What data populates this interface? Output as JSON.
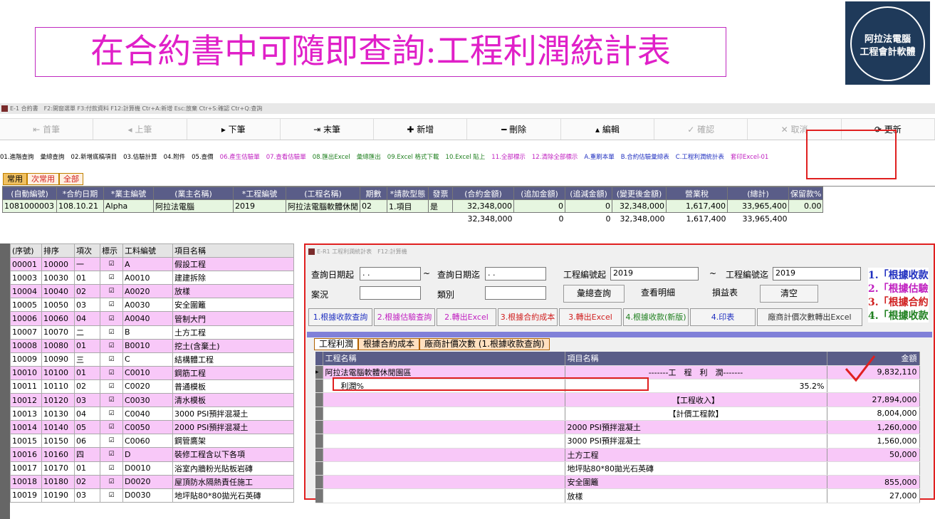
{
  "slide_title": "在合約書中可隨即查詢:工程利潤統計表",
  "logo": {
    "line1": "阿拉法電腦",
    "line2": "工程會計軟體"
  },
  "app_title": "E-1 合約書　F2:開窗選單 F3:付款資料 F12:計算機 Ctr+A:新增 Esc:放棄 Ctr+S:確認 Ctr+Q:查詢",
  "nav": [
    {
      "label": "⇤ 首筆",
      "dim": true
    },
    {
      "label": "◂ 上筆",
      "dim": true
    },
    {
      "label": "▸ 下筆",
      "dim": false
    },
    {
      "label": "⇥ 末筆",
      "dim": false
    },
    {
      "label": "✚ 新增",
      "dim": false
    },
    {
      "label": "━ 刪除",
      "dim": false
    },
    {
      "label": "▴ 編輯",
      "dim": false
    },
    {
      "label": "✓ 確認",
      "dim": true
    },
    {
      "label": "✕ 取消",
      "dim": true
    },
    {
      "label": "⟳ 更新",
      "dim": false
    }
  ],
  "funcs": [
    {
      "label": "01.進階查詢",
      "c": ""
    },
    {
      "label": "彙總查詢",
      "c": ""
    },
    {
      "label": "02.新增底稿項目",
      "c": ""
    },
    {
      "label": "03.估驗計算",
      "c": ""
    },
    {
      "label": "04.附件",
      "c": ""
    },
    {
      "label": "05.查價",
      "c": ""
    },
    {
      "label": "06.產生估驗單",
      "c": "pk"
    },
    {
      "label": "07.查看估驗單",
      "c": "pk"
    },
    {
      "label": "08.匯出Excel",
      "c": "gr"
    },
    {
      "label": "彙總匯出",
      "c": "gr"
    },
    {
      "label": "09.Excel 格式下載",
      "c": "gr"
    },
    {
      "label": "10.Excel 貼上",
      "c": "gr"
    },
    {
      "label": "11.全部標示",
      "c": "pk"
    },
    {
      "label": "12.清除全部標示",
      "c": "pk"
    },
    {
      "label": "A.重刷本單",
      "c": "bl"
    },
    {
      "label": "B.合約估驗彙總表",
      "c": "bl"
    },
    {
      "label": "C.工程利潤統計表",
      "c": "bl"
    },
    {
      "label": "套印Excel-01",
      "c": "pk"
    }
  ],
  "tabs1": [
    "常用",
    "次常用",
    "全部"
  ],
  "top_headers": [
    "(自動編號)",
    "*合約日期",
    "*業主編號",
    "(業主名稱)",
    "*工程編號",
    "(工程名稱)",
    "期數",
    "*請款型態",
    "發票",
    "(合約金額)",
    "(追加金額)",
    "(追減金額)",
    "(變更後金額)",
    "營業稅",
    "(總計)",
    "保留款%"
  ],
  "top_row": [
    "1081000003",
    "108.10.21",
    "Alpha",
    "阿拉法電腦",
    "2019",
    "阿拉法電腦軟體休閒",
    "02",
    "1.項目",
    "是",
    "32,348,000",
    "0",
    "0",
    "32,348,000",
    "1,617,400",
    "33,965,400",
    "0.00"
  ],
  "top_totals": [
    "32,348,000",
    "0",
    "0",
    "32,348,000",
    "1,617,400",
    "33,965,400"
  ],
  "left_headers": [
    "(序號)",
    "排序",
    "項次",
    "標示",
    "工料編號",
    "項目名稱"
  ],
  "left_rows": [
    [
      "00001",
      "10000",
      "一",
      "☑",
      "A",
      "假設工程"
    ],
    [
      "10003",
      "10030",
      "01",
      "☑",
      "A0010",
      "建建拆除"
    ],
    [
      "10004",
      "10040",
      "02",
      "☑",
      "A0020",
      "放樣"
    ],
    [
      "10005",
      "10050",
      "03",
      "☑",
      "A0030",
      "安全圍籬"
    ],
    [
      "10006",
      "10060",
      "04",
      "☑",
      "A0040",
      "管制大門"
    ],
    [
      "10007",
      "10070",
      "二",
      "☑",
      "B",
      "土方工程"
    ],
    [
      "10008",
      "10080",
      "01",
      "☑",
      "B0010",
      "挖土(含棄土)"
    ],
    [
      "10009",
      "10090",
      "三",
      "☑",
      "C",
      "結構體工程"
    ],
    [
      "10010",
      "10100",
      "01",
      "☑",
      "C0010",
      "鋼筋工程"
    ],
    [
      "10011",
      "10110",
      "02",
      "☑",
      "C0020",
      "普通模板"
    ],
    [
      "10012",
      "10120",
      "03",
      "☑",
      "C0030",
      "清水模板"
    ],
    [
      "10013",
      "10130",
      "04",
      "☑",
      "C0040",
      "3000 PSI預拌混凝土"
    ],
    [
      "10014",
      "10140",
      "05",
      "☑",
      "C0050",
      "2000 PSI預拌混凝土"
    ],
    [
      "10015",
      "10150",
      "06",
      "☑",
      "C0060",
      "鋼管鷹架"
    ],
    [
      "10016",
      "10160",
      "四",
      "☑",
      "D",
      "裝修工程含以下各項"
    ],
    [
      "10017",
      "10170",
      "01",
      "☑",
      "D0010",
      "浴室內牆粉光貼板岩磚"
    ],
    [
      "10018",
      "10180",
      "02",
      "☑",
      "D0020",
      "屋頂防水隔熱責任施工"
    ],
    [
      "10019",
      "10190",
      "03",
      "☑",
      "D0030",
      "地坪貼80*80拋光石英磚"
    ]
  ],
  "win": {
    "title": "E-R1 工程利潤統計表　F12:計算機",
    "date_from_label": "查詢日期起",
    "date_from": " . .",
    "tilde": "~",
    "date_to_label": "查詢日期迄",
    "date_to": " . .",
    "proj_from_label": "工程編號起",
    "proj_from": "2019",
    "proj_to_label": "工程編號迄",
    "proj_to": "2019",
    "case_label": "案況",
    "type_label": "類別",
    "btn_summary": "彙總查詢",
    "btn_detail": "查看明細",
    "btn_pl": "損益表",
    "btn_clear": "清空",
    "notes": [
      {
        "t": "1.「根據收款",
        "c": "#2030c0"
      },
      {
        "t": "2.「根據估驗",
        "c": "#c020c0"
      },
      {
        "t": "3.「根據合約",
        "c": "#d02020"
      },
      {
        "t": "4.「根據收款",
        "c": "#208020"
      }
    ],
    "btns2": [
      {
        "t": "1.根據收款查詢",
        "c": "#2030c0"
      },
      {
        "t": "2.根據估驗查詢",
        "c": "#c020c0"
      },
      {
        "t": "2.轉出Excel",
        "c": "#c020c0"
      },
      {
        "t": "3.根據合約成本",
        "c": "#d02020"
      },
      {
        "t": "3.轉出Excel",
        "c": "#d02020"
      },
      {
        "t": "4.根據收款(新版)",
        "c": "#208020"
      },
      {
        "t": "4.印表",
        "c": "#2030c0"
      },
      {
        "t": "廠商計價次數轉出Excel",
        "c": "#333"
      }
    ],
    "tabs": [
      "工程利潤",
      "根據合約成本",
      "廠商計價次數 (1.根據收款查詢)"
    ],
    "grid_headers": [
      "工程名稱",
      "項目名稱",
      "金額"
    ],
    "rows": [
      {
        "a": "阿拉法電腦軟體休閒園區",
        "b": "-------工　程　利　潤-------",
        "c": "9,832,110",
        "p": true,
        "cur": true
      },
      {
        "a": "　　利潤%",
        "b": "35.2%",
        "c": "",
        "p": false
      },
      {
        "a": "",
        "b": "【工程收入】",
        "c": "27,894,000",
        "p": true
      },
      {
        "a": "",
        "b": "【計價工程款】",
        "c": "8,004,000",
        "p": false
      },
      {
        "a": "",
        "b": "2000 PSI預拌混凝土",
        "c": "1,260,000",
        "p": true
      },
      {
        "a": "",
        "b": "3000 PSI預拌混凝土",
        "c": "1,560,000",
        "p": false
      },
      {
        "a": "",
        "b": "土方工程",
        "c": "50,000",
        "p": true
      },
      {
        "a": "",
        "b": "地坪貼80*80拋光石英磚",
        "c": "",
        "p": false
      },
      {
        "a": "",
        "b": "安全圍籬",
        "c": "855,000",
        "p": true
      },
      {
        "a": "",
        "b": "放樣",
        "c": "27,000",
        "p": false
      }
    ]
  }
}
